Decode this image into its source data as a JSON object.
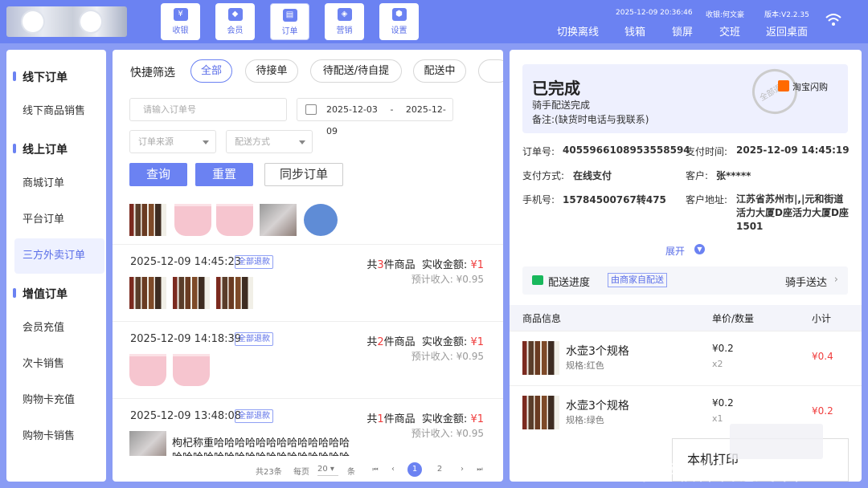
{
  "header": {
    "nav": [
      {
        "label": "收银",
        "icon": "cash-icon"
      },
      {
        "label": "会员",
        "icon": "diamond-icon"
      },
      {
        "label": "订单",
        "icon": "clipboard-icon"
      },
      {
        "label": "营销",
        "icon": "tag-icon"
      },
      {
        "label": "设置",
        "icon": "gear-icon"
      }
    ],
    "datetime": "2025-12-09 20:36:46",
    "cashier": "收银:何文豪",
    "version": "版本:V2.2.35",
    "actions": [
      "切换离线",
      "钱箱",
      "锁屏",
      "交班",
      "返回桌面"
    ]
  },
  "sidebar": {
    "sections": [
      {
        "title": "线下订单",
        "items": [
          "线下商品销售"
        ]
      },
      {
        "title": "线上订单",
        "items": [
          "商城订单",
          "平台订单",
          "三方外卖订单"
        ]
      },
      {
        "title": "增值订单",
        "items": [
          "会员充值",
          "次卡销售",
          "购物卡充值",
          "购物卡销售"
        ]
      }
    ],
    "selected": "三方外卖订单"
  },
  "filters": {
    "label": "快捷筛选",
    "chips": [
      "全部",
      "待接单",
      "待配送/待自提",
      "配送中"
    ],
    "order_placeholder": "请输入订单号",
    "date_from": "2025-12-03",
    "date_sep": "-",
    "date_to": "2025-12-09",
    "source_placeholder": "订单来源",
    "delivery_placeholder": "配送方式",
    "query": "查询",
    "reset": "重置",
    "sync": "同步订单"
  },
  "orders": [
    {
      "date": "2025-12-09 14:45:23",
      "tag": "全部退款",
      "count_pre": "共",
      "count": "3",
      "count_post": "件商品",
      "amount_label": "实收金额:",
      "amount": "¥1",
      "est": "预计收入: ¥0.95"
    },
    {
      "date": "2025-12-09 14:18:39",
      "tag": "全部退款",
      "count_pre": "共",
      "count": "2",
      "count_post": "件商品",
      "amount_label": "实收金额:",
      "amount": "¥1",
      "est": "预计收入: ¥0.95"
    },
    {
      "date": "2025-12-09 13:48:08",
      "tag": "全部退款",
      "count_pre": "共",
      "count": "1",
      "count_post": "件商品",
      "amount_label": "实收金额:",
      "amount": "¥1",
      "est": "预计收入: ¥0.95",
      "desc": "枸杞称重哈哈哈哈哈哈哈哈哈哈哈哈哈",
      "desc2": "哈哈哈哈哈哈哈哈哈哈哈哈哈哈哈哈哈"
    }
  ],
  "pager": {
    "total": "共23条",
    "per_label": "每页",
    "per": "20",
    "unit": "条",
    "first": "⏮",
    "prev": "‹",
    "pages": [
      "1",
      "2"
    ],
    "next": "›",
    "last": "⏭"
  },
  "detail": {
    "status": "已完成",
    "sub": "骑手配送完成",
    "note": "备注:(缺货时电话与我联系)",
    "stamp": "全部退款",
    "platform": "淘宝闪购",
    "order_no_label": "订单号:",
    "order_no": "4055966108953558594",
    "pay_time_label": "支付时间:",
    "pay_time": "2025-12-09 14:45:19",
    "pay_method_label": "支付方式:",
    "pay_method": "在线支付",
    "customer_label": "客户:",
    "customer": "张*****",
    "phone_label": "手机号:",
    "phone": "15784500767转475",
    "address_label": "客户地址:",
    "address": "江苏省苏州市|,|元和街道活力大厦D座活力大厦D座1501",
    "expand": "展开",
    "progress_label": "配送进度",
    "progress_tag": "由商家自配送",
    "progress_value": "骑手送达",
    "table_headers": [
      "商品信息",
      "单价/数量",
      "小计"
    ],
    "items": [
      {
        "name": "水壶3个规格",
        "spec": "规格:红色",
        "price": "¥0.2",
        "qty": "x2",
        "subtotal": "¥0.4"
      },
      {
        "name": "水壶3个规格",
        "spec": "规格:绿色",
        "price": "¥0.2",
        "qty": "x1",
        "subtotal": "¥0.2"
      }
    ],
    "print": "本机打印"
  },
  "watermark": "千呼软件智慧零售2.0"
}
